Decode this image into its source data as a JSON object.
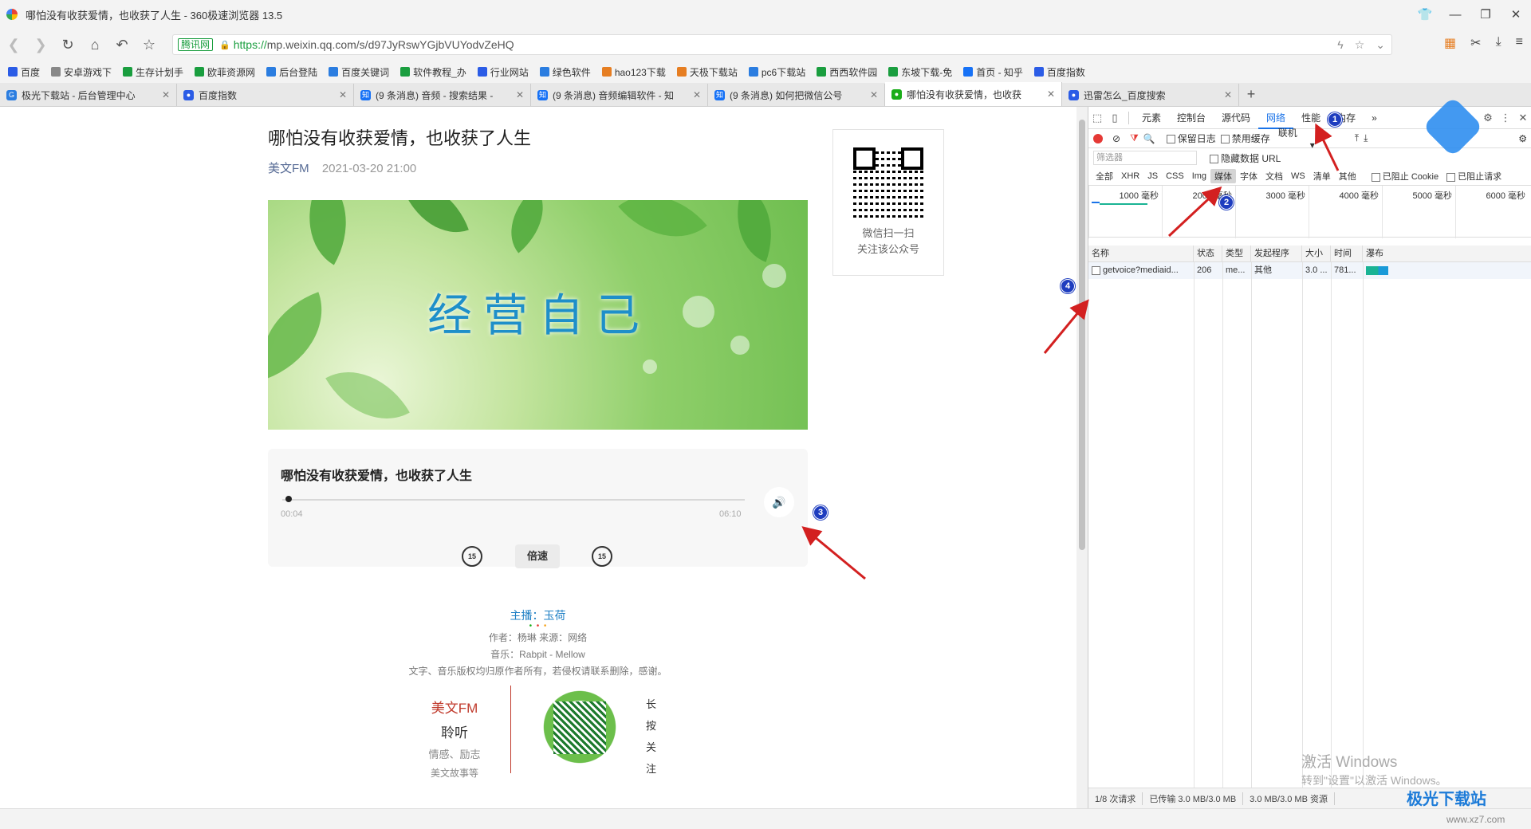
{
  "window": {
    "title": "哪怕没有收获爱情，也收获了人生 - 360极速浏览器 13.5"
  },
  "address": {
    "site_badge": "腾讯网",
    "url_proto": "https://",
    "url_rest": "mp.weixin.qq.com/s/d97JyRswYGjbVUYodvZeHQ"
  },
  "bookmarks": [
    {
      "label": "百度",
      "color": "#2b5ce6"
    },
    {
      "label": "安卓游戏下",
      "color": "#888888"
    },
    {
      "label": "生存计划手",
      "color": "#1a9e3f"
    },
    {
      "label": "欧菲资源网",
      "color": "#1a9e3f"
    },
    {
      "label": "后台登陆",
      "color": "#2b7de0"
    },
    {
      "label": "百度关键词",
      "color": "#2b7de0"
    },
    {
      "label": "软件教程_办",
      "color": "#1a9e3f"
    },
    {
      "label": "行业网站",
      "color": "#2b5ce6"
    },
    {
      "label": "绿色软件",
      "color": "#2b7de0"
    },
    {
      "label": "hao123下载",
      "color": "#e67e22"
    },
    {
      "label": "天极下载站",
      "color": "#e67e22"
    },
    {
      "label": "pc6下载站",
      "color": "#2b7de0"
    },
    {
      "label": "西西软件园",
      "color": "#1a9e3f"
    },
    {
      "label": "东坡下载-免",
      "color": "#1a9e3f"
    },
    {
      "label": "首页 - 知乎",
      "color": "#1772f6"
    },
    {
      "label": "百度指数",
      "color": "#2b5ce6"
    }
  ],
  "tabs": [
    {
      "label": "极光下载站 - 后台管理中心",
      "color": "#2b7de0",
      "glyph": "G"
    },
    {
      "label": "百度指数",
      "color": "#2b5ce6",
      "glyph": "●"
    },
    {
      "label": "(9 条消息) 音频 - 搜索结果 - ",
      "color": "#1772f6",
      "glyph": "知"
    },
    {
      "label": "(9 条消息) 音频编辑软件 - 知",
      "color": "#1772f6",
      "glyph": "知"
    },
    {
      "label": "(9 条消息) 如何把微信公号",
      "color": "#1772f6",
      "glyph": "知"
    },
    {
      "label": "哪怕没有收获爱情，也收获",
      "color": "#1aad19",
      "glyph": "●",
      "active": true
    },
    {
      "label": "迅雷怎么_百度搜索",
      "color": "#2b5ce6",
      "glyph": "●"
    }
  ],
  "article": {
    "title": "哪怕没有收获爱情，也收获了人生",
    "source": "美文FM",
    "date": "2021-03-20 21:00",
    "qr_text1": "微信扫一扫",
    "qr_text2": "关注该公众号",
    "banner_text": "经营自己",
    "audio": {
      "title": "哪怕没有收获爱情，也收获了人生",
      "current": "00:04",
      "duration": "06:10",
      "speed": "倍速",
      "rew": "15",
      "fwd": "15",
      "progress": 0.011
    },
    "host": "主播：玉荷",
    "author_line": "作者：杨琳    来源：网络",
    "music_line": "音乐：Rabpit - Mellow",
    "copyright": "文字、音乐版权均归原作者所有，若侵权请联系删除，感谢。",
    "bottom": {
      "b1": "美文FM",
      "b2": "聆听",
      "b3": "情感、励志",
      "b4": "美文故事等"
    },
    "vertical": [
      "长",
      "按",
      "关",
      "注"
    ]
  },
  "devtools": {
    "tabs": [
      "元素",
      "控制台",
      "源代码",
      "网络",
      "性能",
      "内存",
      "»"
    ],
    "active_tab": "网络",
    "preserve_log": "保留日志",
    "disable_cache": "禁用缓存",
    "throttle": "联机",
    "filter_placeholder": "筛选器",
    "hide_data_url": "隐藏数据 URL",
    "types": [
      "全部",
      "XHR",
      "JS",
      "CSS",
      "Img",
      "媒体",
      "字体",
      "文档",
      "WS",
      "清单",
      "其他"
    ],
    "selected_type": "媒体",
    "blocked_cookie": "已阻止 Cookie",
    "blocked_requests": "已阻止请求",
    "timeline_ticks": [
      "1000 毫秒",
      "2000 毫秒",
      "3000 毫秒",
      "4000 毫秒",
      "5000 毫秒",
      "6000 毫秒"
    ],
    "columns": [
      "名称",
      "状态",
      "类型",
      "发起程序",
      "大小",
      "时间",
      "瀑布"
    ],
    "rows": [
      {
        "name": "getvoice?mediaid...",
        "status": "206",
        "type": "me...",
        "initiator": "其他",
        "size": "3.0 ...",
        "time": "781..."
      }
    ],
    "footer": [
      "1/8 次请求",
      "已传输 3.0 MB/3.0 MB",
      "3.0 MB/3.0 MB 资源"
    ]
  },
  "watermark": {
    "line1": "激活 Windows",
    "line2": "转到\"设置\"以激活 Windows。"
  },
  "brand": {
    "name": "极光下载站",
    "url": "www.xz7.com"
  },
  "badges": [
    "1",
    "2",
    "3",
    "4"
  ]
}
